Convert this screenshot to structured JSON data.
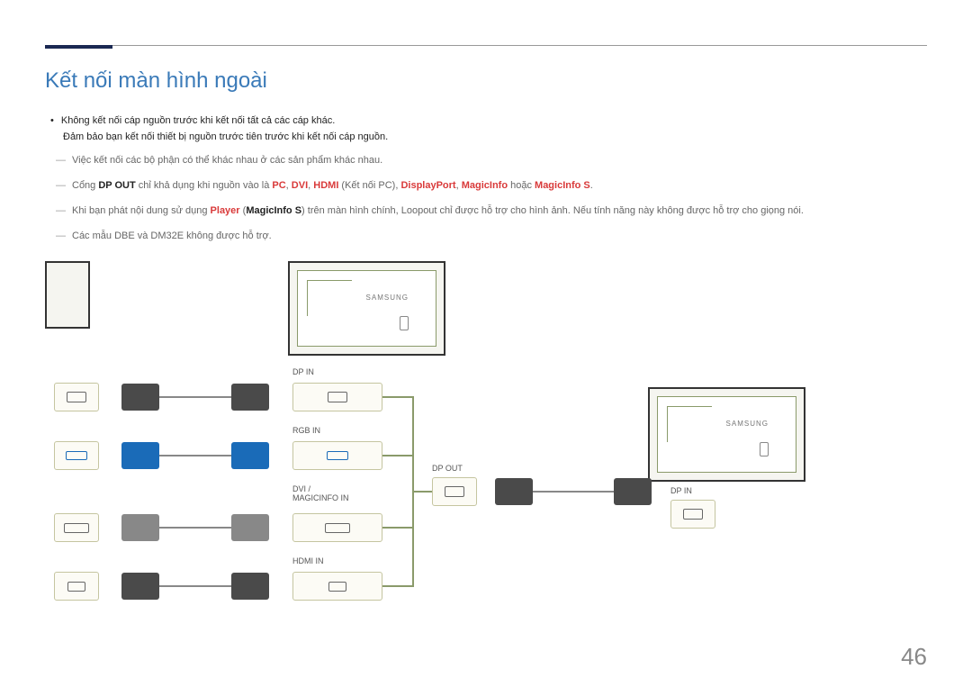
{
  "title": "Kết nối màn hình ngoài",
  "bullet1": "Không kết nối cáp nguồn trước khi kết nối tất cả các cáp khác.",
  "bullet1_sub": "Đảm bảo bạn kết nối thiết bị nguồn trước tiên trước khi kết nối cáp nguồn.",
  "note1": "Việc kết nối các bộ phận có thể khác nhau ở các sản phẩm khác nhau.",
  "note2_pre": "Cổng ",
  "note2_b1": "DP OUT",
  "note2_mid1": " chỉ khả dụng khi nguồn vào là ",
  "note2_r1": "PC",
  "note2_c1": ", ",
  "note2_r2": "DVI",
  "note2_c2": ", ",
  "note2_r3": "HDMI",
  "note2_mid2": " (Kết nối PC), ",
  "note2_r4": "DisplayPort",
  "note2_c3": ", ",
  "note2_r5": "MagicInfo",
  "note2_mid3": " hoặc ",
  "note2_r6": "MagicInfo S",
  "note2_end": ".",
  "note3_pre": "Khi bạn phát nội dung sử dụng ",
  "note3_r1": "Player",
  "note3_mid1": " (",
  "note3_b1": "MagicInfo S",
  "note3_end": ") trên màn hình chính, Loopout chỉ được hỗ trợ cho hình ảnh. Nếu tính năng này không được hỗ trợ cho giọng nói.",
  "note4": "Các mẫu DBE và DM32E không được hỗ trợ.",
  "labels": {
    "dp_in": "DP IN",
    "rgb_in": "RGB IN",
    "dvi_magicinfo": "DVI /\nMAGICINFO IN",
    "hdmi_in": "HDMI IN",
    "dp_out": "DP OUT",
    "dp_in2": "DP IN"
  },
  "brand": "SAMSUNG",
  "page_number": "46"
}
